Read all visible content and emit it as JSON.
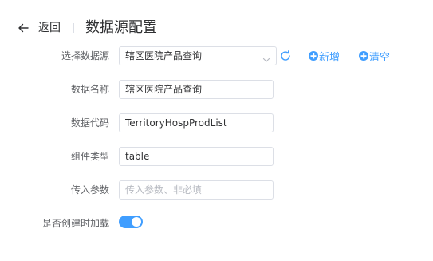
{
  "header": {
    "back_label": "返回",
    "title": "数据源配置"
  },
  "icons": {
    "back": "arrow-left-icon",
    "refresh": "refresh-icon",
    "dropdown": "chevron-down-icon",
    "add": "plus-circle-icon"
  },
  "colors": {
    "accent": "#409eff",
    "label": "#606266",
    "border": "#dcdfe6",
    "placeholder": "#b7bac1",
    "title": "#303133"
  },
  "form": {
    "datasource": {
      "label": "选择数据源",
      "value": "辖区医院产品查询",
      "add_label": "新增",
      "clear_label": "清空"
    },
    "name": {
      "label": "数据名称",
      "value": "辖区医院产品查询"
    },
    "code": {
      "label": "数据代码",
      "value": "TerritoryHospProdList"
    },
    "component_type": {
      "label": "组件类型",
      "value": "table"
    },
    "params": {
      "label": "传入参数",
      "value": "",
      "placeholder": "传入参数、非必填"
    },
    "load_on_create": {
      "label": "是否创建时加载",
      "enabled": true
    }
  }
}
